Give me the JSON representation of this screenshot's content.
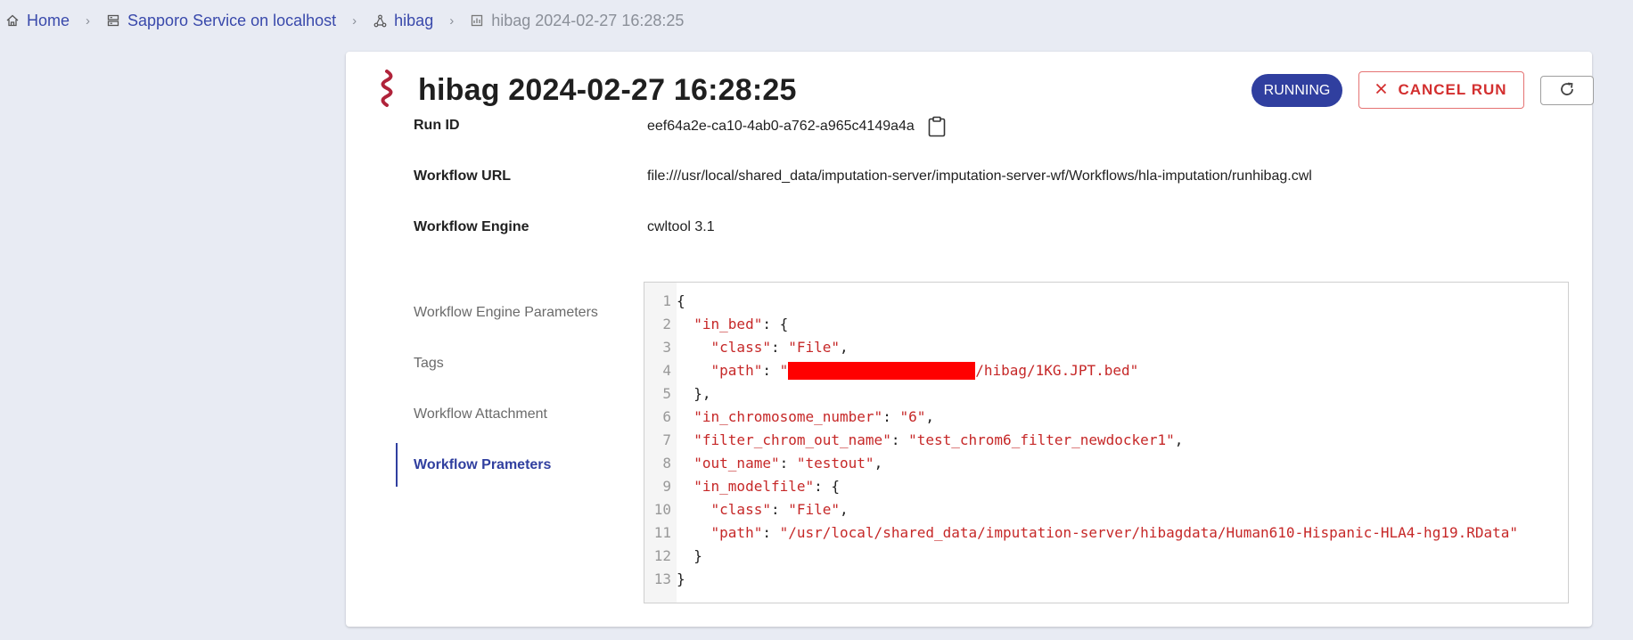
{
  "breadcrumb": {
    "home": "Home",
    "service": "Sapporo Service on localhost",
    "workflow": "hibag",
    "run": "hibag 2024-02-27 16:28:25"
  },
  "run": {
    "title": "hibag 2024-02-27 16:28:25",
    "status": "RUNNING",
    "cancel_label": "CANCEL RUN"
  },
  "info": {
    "run_id_label": "Run ID",
    "run_id": "eef64a2e-ca10-4ab0-a762-a965c4149a4a",
    "workflow_url_label": "Workflow URL",
    "workflow_url": "file:///usr/local/shared_data/imputation-server/imputation-server-wf/Workflows/hla-imputation/runhibag.cwl",
    "workflow_engine_label": "Workflow Engine",
    "workflow_engine": "cwltool 3.1"
  },
  "tabs": [
    {
      "label": "Workflow Engine Parameters"
    },
    {
      "label": "Tags"
    },
    {
      "label": "Workflow Attachment"
    },
    {
      "label": "Workflow Prameters"
    }
  ],
  "editor": {
    "lines": [
      {
        "n": "1",
        "t": "{"
      },
      {
        "n": "2",
        "t": "  \"in_bed\": {"
      },
      {
        "n": "3",
        "t": "    \"class\": \"File\","
      },
      {
        "n": "4",
        "t": "    \"path\": \"[REDACTED]/hibag/1KG.JPT.bed\""
      },
      {
        "n": "5",
        "t": "  },"
      },
      {
        "n": "6",
        "t": "  \"in_chromosome_number\": \"6\","
      },
      {
        "n": "7",
        "t": "  \"filter_chrom_out_name\": \"test_chrom6_filter_newdocker1\","
      },
      {
        "n": "8",
        "t": "  \"out_name\": \"testout\","
      },
      {
        "n": "9",
        "t": "  \"in_modelfile\": {"
      },
      {
        "n": "10",
        "t": "    \"class\": \"File\","
      },
      {
        "n": "11",
        "t": "    \"path\": \"/usr/local/shared_data/imputation-server/hibagdata/Human610-Hispanic-HLA4-hg19.RData\""
      },
      {
        "n": "12",
        "t": "  }"
      },
      {
        "n": "13",
        "t": "}"
      }
    ]
  },
  "colors": {
    "accent": "#303f9f",
    "cancel": "#d32f2f",
    "logo": "#b0233a",
    "code_string": "#c62828",
    "background": "#e8ebf3"
  },
  "icons": {
    "home": "home-icon",
    "service": "server-icon",
    "workflow": "workflow-icon",
    "run": "run-icon",
    "copy": "clipboard-icon",
    "cancel": "close-icon",
    "refresh": "refresh-icon"
  }
}
